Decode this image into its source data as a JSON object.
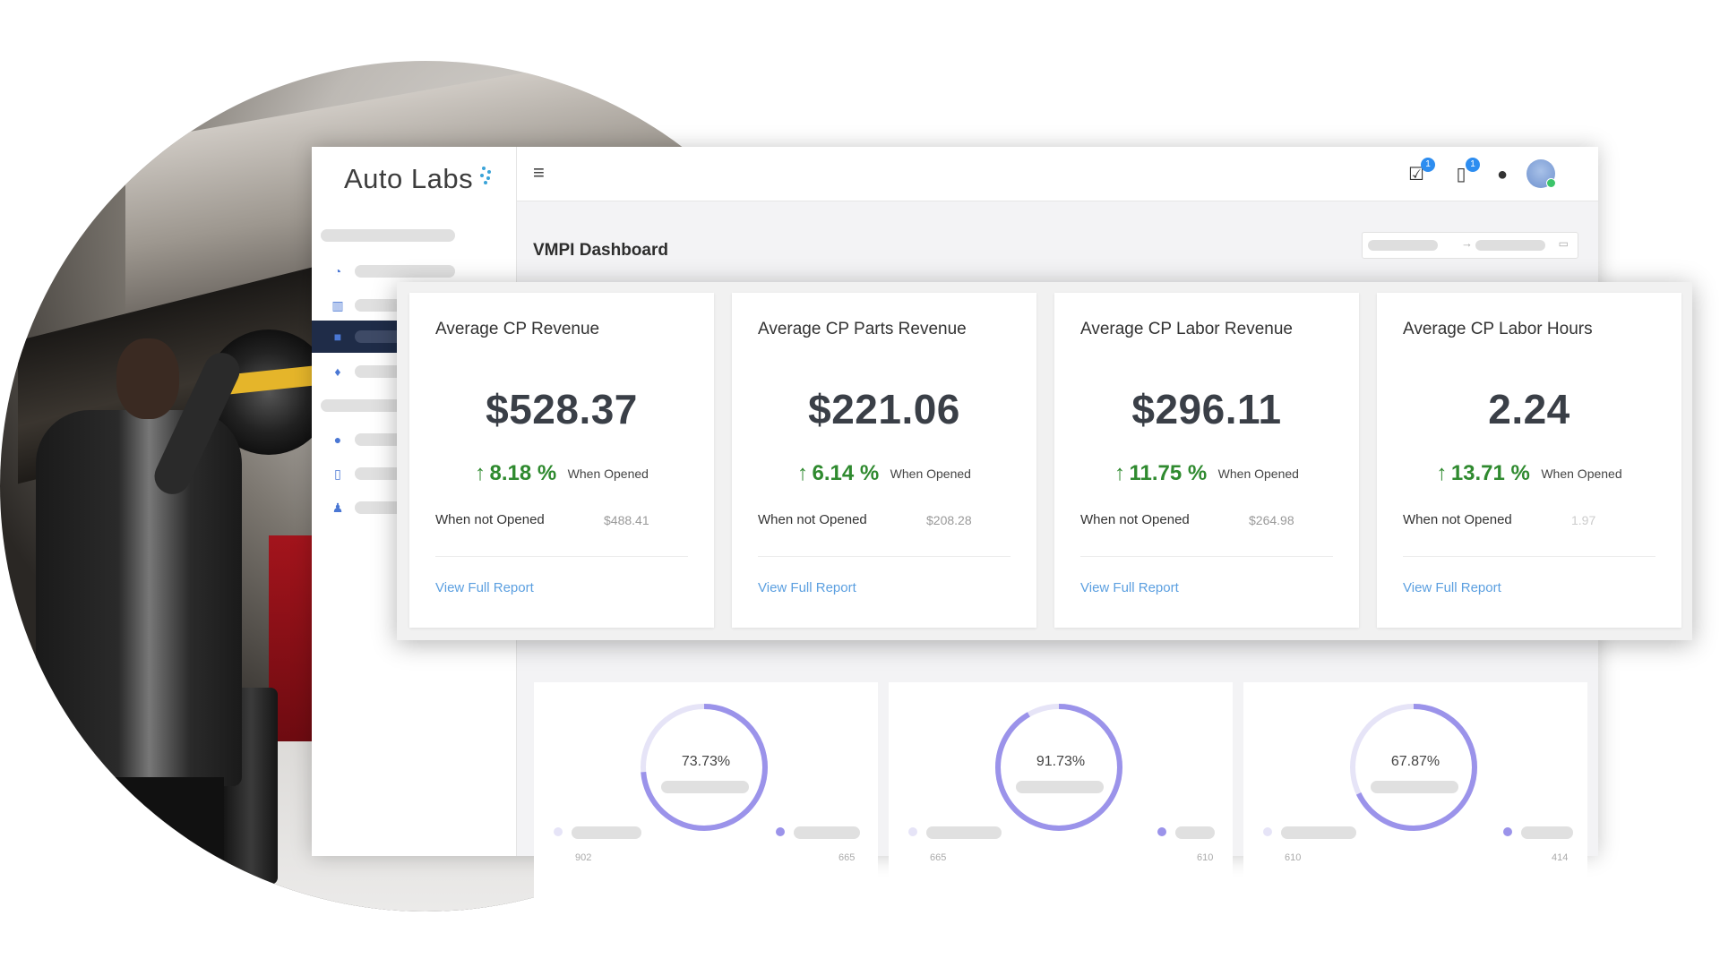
{
  "app": {
    "logo": "Auto Labs"
  },
  "header": {
    "page_title": "VMPI Dashboard",
    "badges": {
      "tasks": "1",
      "devices": "1"
    }
  },
  "kpi_cards": [
    {
      "title": "Average CP Revenue",
      "value": "$528.37",
      "change": "8.18 %",
      "opened_label": "When Opened",
      "not_opened_label": "When not Opened",
      "not_opened_value": "$488.41",
      "link": "View Full Report"
    },
    {
      "title": "Average CP Parts Revenue",
      "value": "$221.06",
      "change": "6.14 %",
      "opened_label": "When Opened",
      "not_opened_label": "When not Opened",
      "not_opened_value": "$208.28",
      "link": "View Full Report"
    },
    {
      "title": "Average CP Labor Revenue",
      "value": "$296.11",
      "change": "11.75 %",
      "opened_label": "When Opened",
      "not_opened_label": "When not Opened",
      "not_opened_value": "$264.98",
      "link": "View Full Report"
    },
    {
      "title": "Average CP Labor Hours",
      "value": "2.24",
      "change": "13.71 %",
      "opened_label": "When Opened",
      "not_opened_label": "When not Opened",
      "not_opened_value": "1.97",
      "link": "View Full Report"
    }
  ],
  "donuts": [
    {
      "percent_label": "73.73%",
      "percent": 73.73,
      "left_value": "902",
      "right_value": "665"
    },
    {
      "percent_label": "91.73%",
      "percent": 91.73,
      "left_value": "665",
      "right_value": "610"
    },
    {
      "percent_label": "67.87%",
      "percent": 67.87,
      "left_value": "610",
      "right_value": "414"
    }
  ],
  "colors": {
    "sidebar_active": "#1f2c48",
    "accent_blue": "#2d8df0",
    "positive_green": "#2f8a2f",
    "link_blue": "#5b9fe0",
    "donut_ring": "#9b93ea",
    "donut_track": "#e6e4f7"
  },
  "icons": {
    "menu": "hamburger-icon",
    "tasks": "checkbox-icon",
    "device": "phone-icon",
    "chat": "chat-icon",
    "user": "avatar"
  }
}
